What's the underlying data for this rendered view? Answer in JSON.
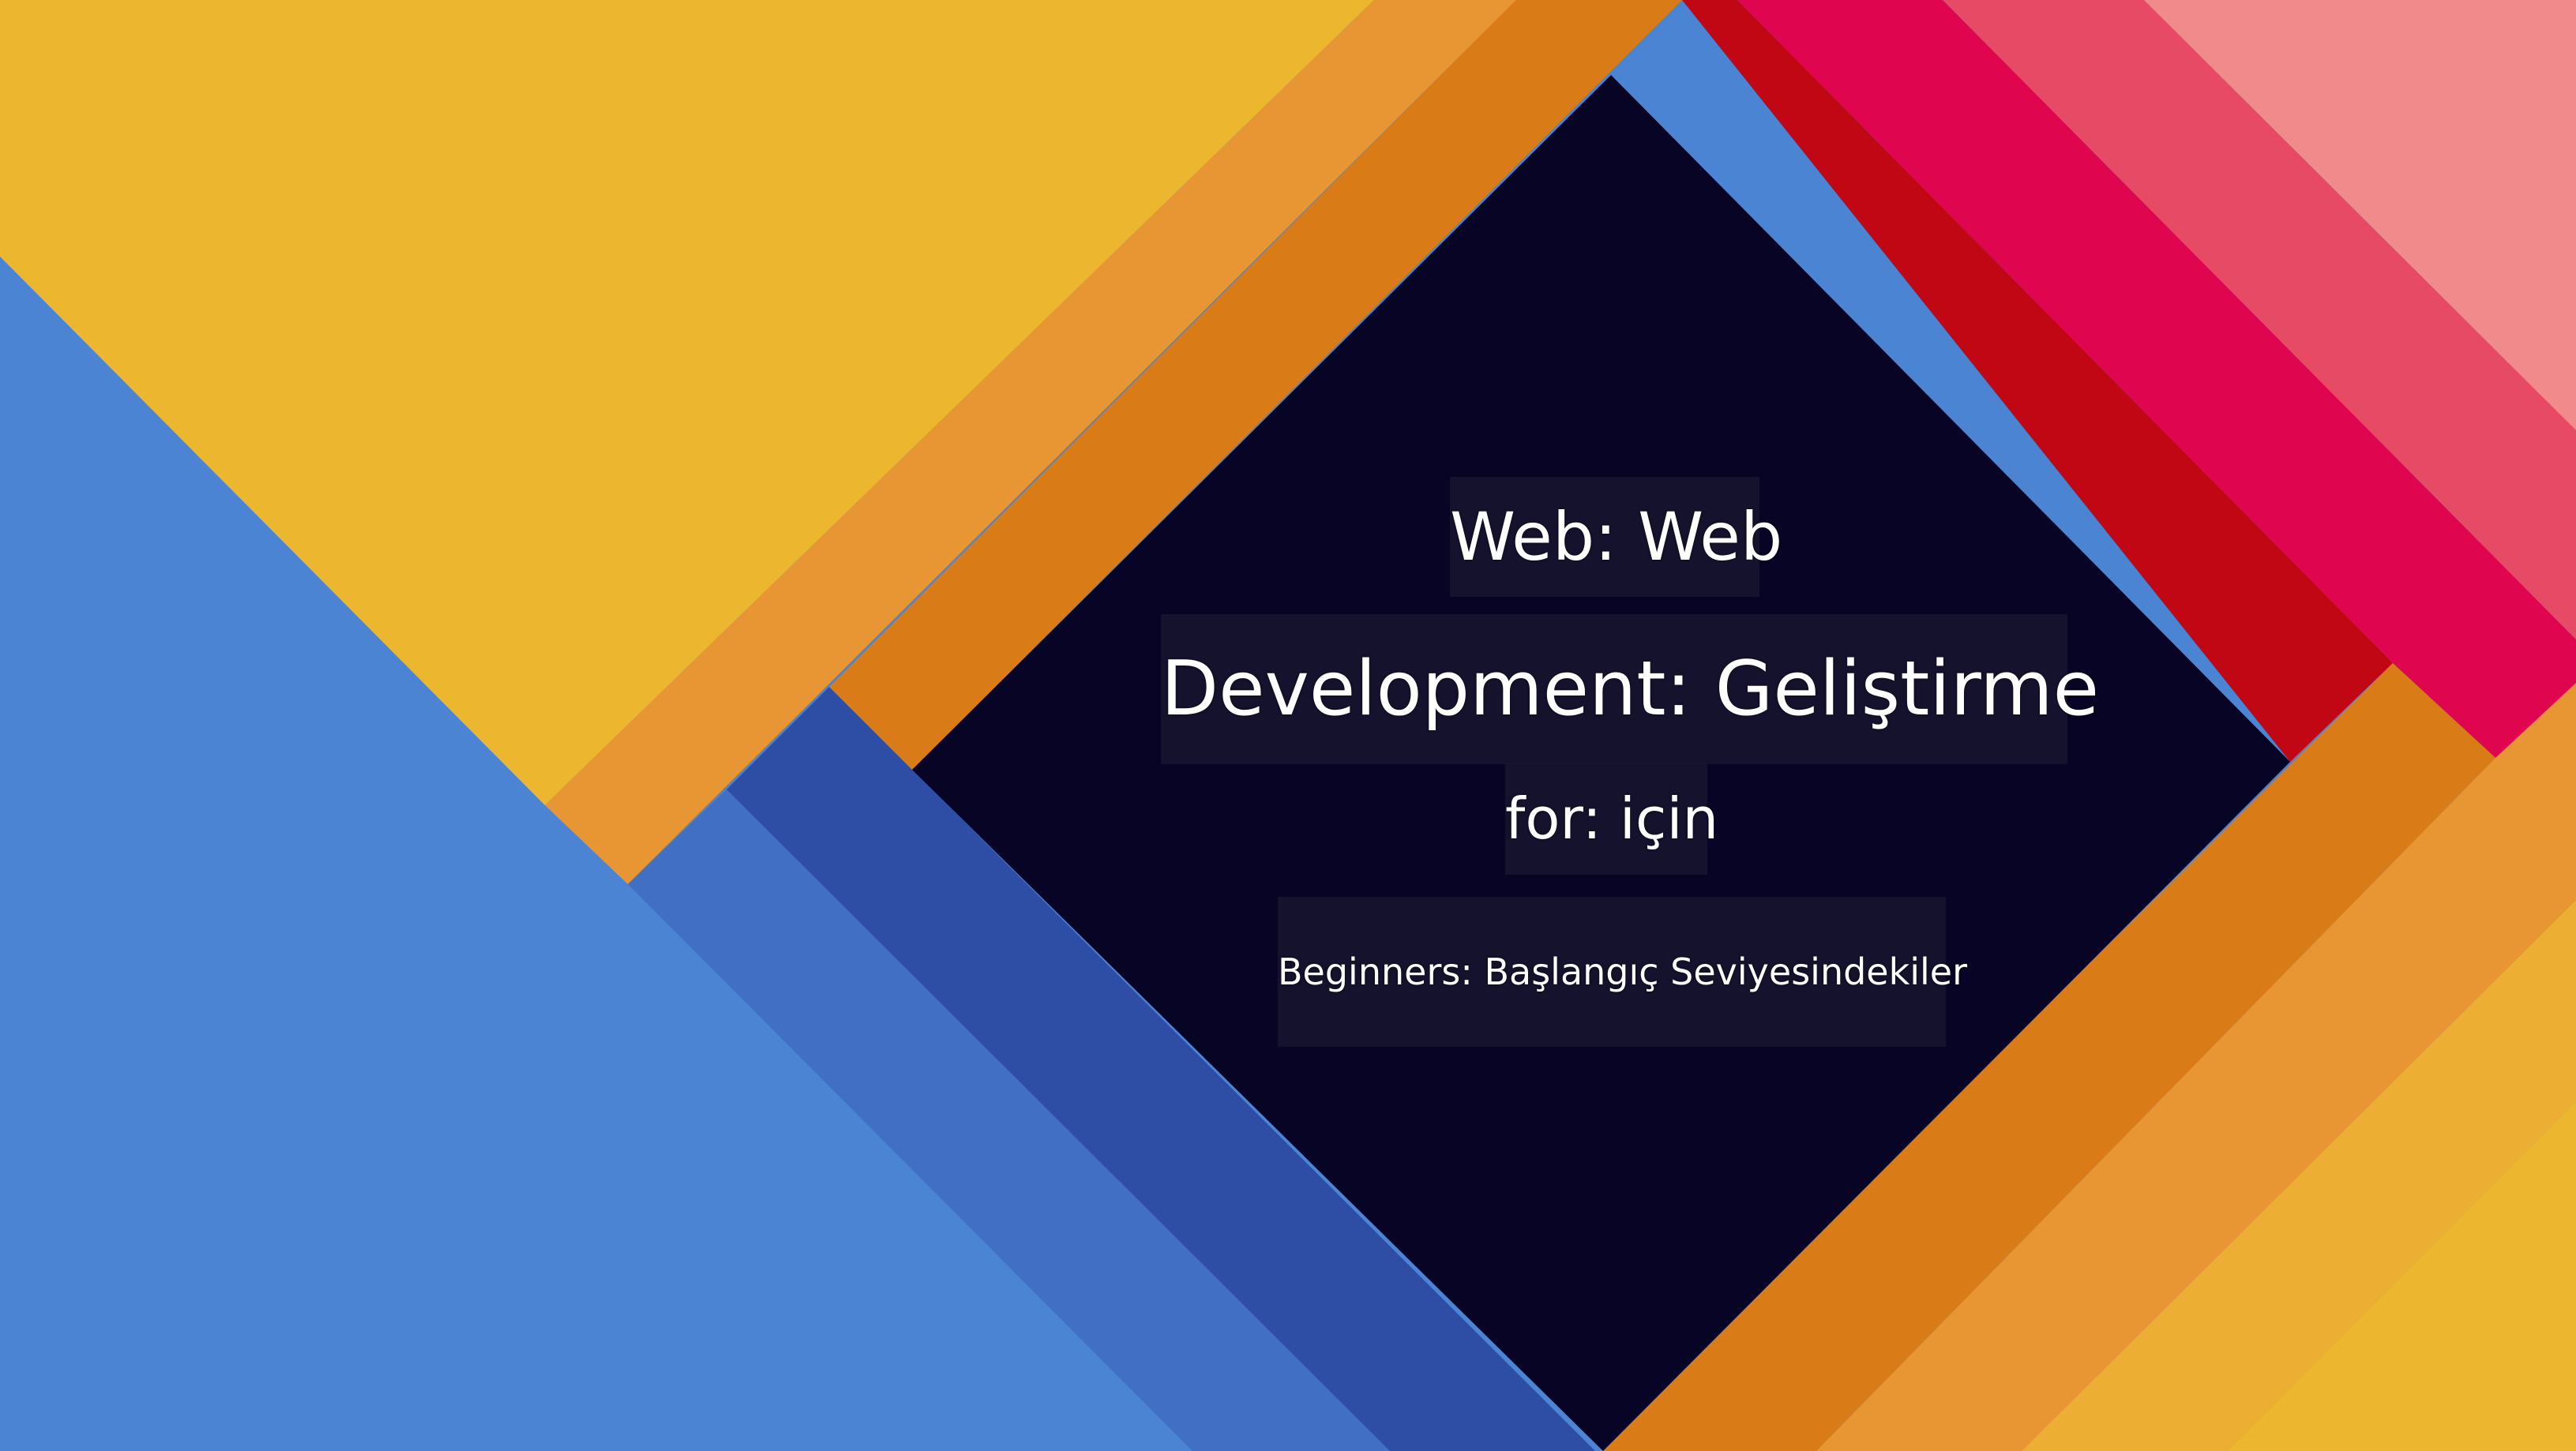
{
  "slide": {
    "line1": "Web: Web",
    "line2": "Development: Geliştirme",
    "line3": "for: için",
    "line4": "Beginners: Başlangıç Seviyesindekiler"
  },
  "colors": {
    "blue_light": "#4a84d3",
    "blue_mid": "#416fc4",
    "blue_dark": "#2e4ea6",
    "yellow": "#ecb72f",
    "orange_light": "#e89534",
    "orange": "#d97b16",
    "navy": "#070425",
    "red": "#c20714",
    "crimson": "#e0054f",
    "rose": "#e64a65",
    "pink": "#f08a8b"
  }
}
